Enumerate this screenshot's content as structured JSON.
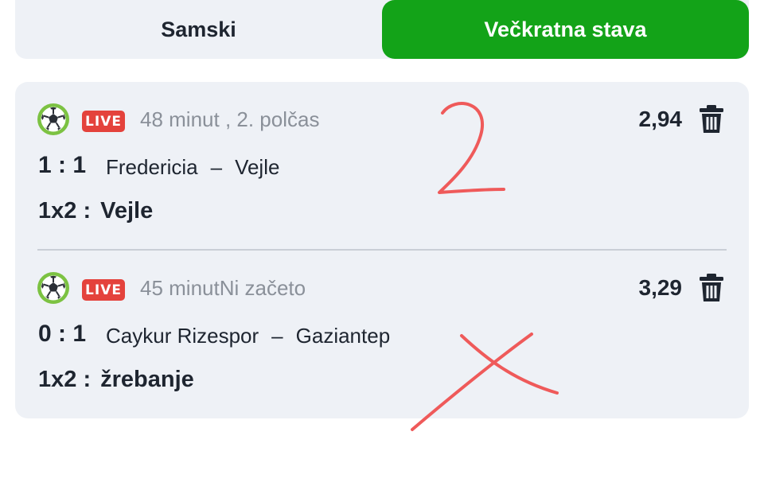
{
  "tabs": {
    "single_label": "Samski",
    "multi_label": "Večkratna stava",
    "active_color": "#13a318"
  },
  "bets": [
    {
      "live_badge": "LIVE",
      "status": "48 minut , 2. polčas",
      "odds": "2,94",
      "score": "1 : 1",
      "home": "Fredericia",
      "separator": "–",
      "away": "Vejle",
      "market": "1x2 :",
      "pick": "Vejle",
      "icons": [
        "soccer-ball-icon",
        "trash-icon"
      ]
    },
    {
      "live_badge": "LIVE",
      "status": "45 minutNi začeto",
      "odds": "3,29",
      "score": "0 : 1",
      "home": "Caykur Rizespor",
      "separator": "–",
      "away": "Gaziantep",
      "market": "1x2 :",
      "pick": "žrebanje",
      "icons": [
        "soccer-ball-icon",
        "trash-icon"
      ]
    }
  ],
  "annotations": {
    "ink_color": "#ef5a5a",
    "marks": [
      "2",
      "X"
    ]
  }
}
